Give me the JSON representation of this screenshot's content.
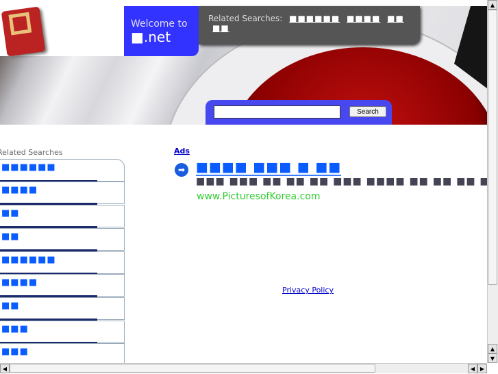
{
  "header": {
    "welcome": "Welcome to",
    "domain": "■.net",
    "related_label": "Related Searches:",
    "related_links": [
      "■■■■■■",
      "■■■■",
      "■■",
      "■■"
    ]
  },
  "search": {
    "value": "",
    "button": "Search"
  },
  "sidebar": {
    "title": "Related Searches",
    "items": [
      "■■■■■■",
      "■■■■",
      "■■",
      "■■",
      "■■■■■■",
      "■■■■",
      "■■",
      "■■■",
      "■■■"
    ]
  },
  "ads": {
    "label": "Ads",
    "title": "■■■■ ■■■ ■ ■■",
    "description": "■■■ ■■■ ■■ ■■ ■■ ■■■ ■■■■ ■■ ■■ ■■ ■■",
    "url": "www.PicturesofKorea.com"
  },
  "footer": {
    "privacy": "Privacy Policy"
  },
  "colors": {
    "accent_blue": "#3333ff",
    "link": "#0a5cff",
    "url_green": "#33cc33"
  }
}
